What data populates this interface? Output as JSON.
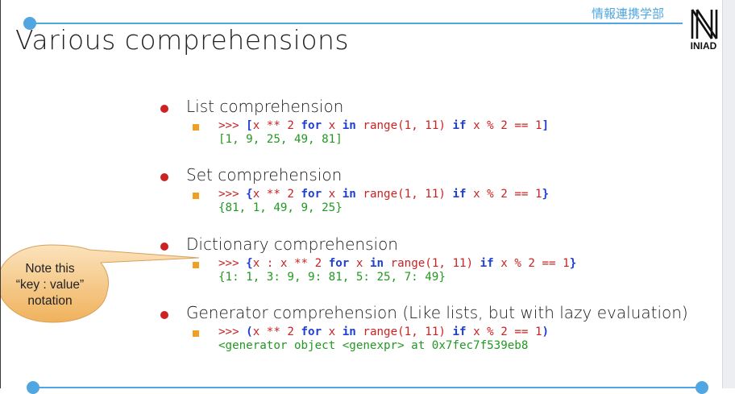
{
  "header": {
    "department": "情報連携学部",
    "logo_text": "INIAD"
  },
  "title": "Various comprehensions",
  "items": [
    {
      "heading": "List comprehension",
      "code": {
        "prompt": ">>> ",
        "open": "[",
        "expr": "x ** 2 ",
        "kw_for": "for",
        "var": " x ",
        "kw_in": "in",
        "rest": " range(1, 11) ",
        "kw_if": "if",
        "cond": " x % 2 == 1",
        "close": "]",
        "output": "[1, 9, 25, 49, 81]"
      }
    },
    {
      "heading": "Set comprehension",
      "code": {
        "prompt": ">>> ",
        "open": "{",
        "expr": "x ** 2 ",
        "kw_for": "for",
        "var": " x ",
        "kw_in": "in",
        "rest": " range(1, 11) ",
        "kw_if": "if",
        "cond": " x % 2 == 1",
        "close": "}",
        "output": "{81, 1, 49, 9, 25}"
      }
    },
    {
      "heading": "Dictionary comprehension",
      "code": {
        "prompt": ">>> ",
        "open": "{",
        "expr": "x : x ** 2 ",
        "kw_for": "for",
        "var": " x ",
        "kw_in": "in",
        "rest": " range(1, 11) ",
        "kw_if": "if",
        "cond": " x % 2 == 1",
        "close": "}",
        "output": "{1: 1, 3: 9, 9: 81, 5: 25, 7: 49}"
      }
    },
    {
      "heading": "Generator comprehension (Like lists, but with lazy evaluation)",
      "code": {
        "prompt": ">>> ",
        "open": "(",
        "expr": "x ** 2 ",
        "kw_for": "for",
        "var": " x ",
        "kw_in": "in",
        "rest": " range(1, 11) ",
        "kw_if": "if",
        "cond": " x % 2 == 1",
        "close": ")",
        "output": "<generator object <genexpr> at 0x7fec7f539eb8"
      }
    }
  ],
  "callout": {
    "line1": "Note this",
    "line2": "“key : value”",
    "line3": "notation"
  },
  "colors": {
    "accent_line": "#4fa6e0",
    "bullet": "#cc2222",
    "sub_bullet": "#f0a020",
    "keyword": "#1f3fd6",
    "code_red": "#cc2222",
    "output_green": "#229922",
    "callout_fill": "#f5c27a"
  }
}
